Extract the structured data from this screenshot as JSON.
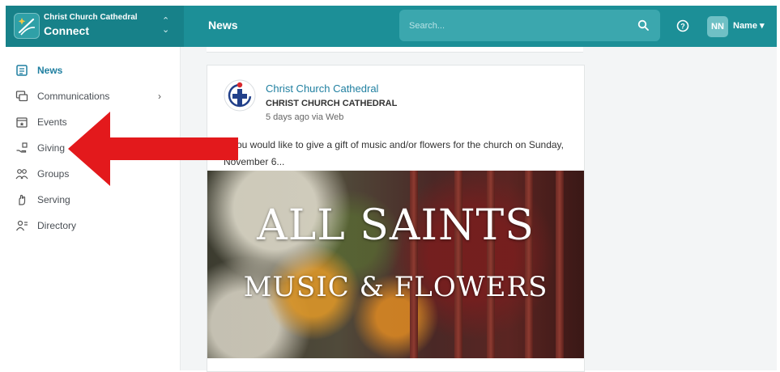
{
  "header": {
    "org_name": "Christ Church Cathedral",
    "app_name": "Connect",
    "page_title": "News",
    "search_placeholder": "Search...",
    "avatar_initials": "NN",
    "user_name": "Name",
    "colors": {
      "bar": "#1c8f97",
      "org_block": "#178189",
      "search": "#3ba7ae"
    }
  },
  "sidebar": {
    "items": [
      {
        "label": "News",
        "icon": "news-icon",
        "active": true
      },
      {
        "label": "Communications",
        "icon": "communications-icon",
        "has_submenu": true
      },
      {
        "label": "Events",
        "icon": "events-icon"
      },
      {
        "label": "Giving",
        "icon": "giving-icon"
      },
      {
        "label": "Groups",
        "icon": "groups-icon"
      },
      {
        "label": "Serving",
        "icon": "serving-icon"
      },
      {
        "label": "Directory",
        "icon": "directory-icon"
      }
    ],
    "active_color": "#1f7fa0"
  },
  "post": {
    "author": "Christ Church Cathedral",
    "organization": "CHRIST CHURCH CATHEDRAL",
    "meta": "5 days ago via Web",
    "text": "If you would like to give a gift of music and/or flowers for the church on Sunday, November 6...",
    "image_title_line1": "ALL SAINTS",
    "image_title_line2": "MUSIC & FLOWERS"
  },
  "annotation": {
    "type": "red-arrow",
    "points_to": "Giving",
    "color": "#e3191c"
  }
}
